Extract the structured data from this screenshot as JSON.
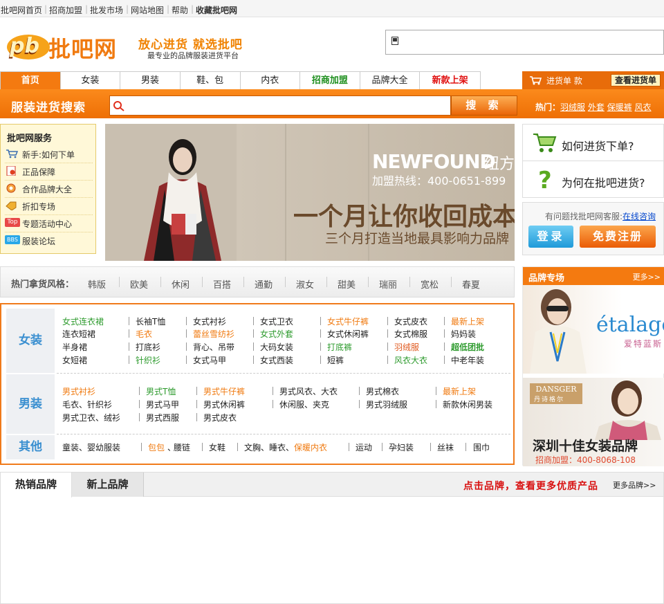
{
  "topbar": {
    "links": [
      "批吧网首页",
      "招商加盟",
      "批发市场",
      "网站地图",
      "帮助",
      "收藏批吧网"
    ]
  },
  "header": {
    "logo_text": "批吧网",
    "slogan": "放心进货  就选批吧",
    "subslogan": "最专业的品牌服装进货平台"
  },
  "nav": {
    "items": [
      "首页",
      "女装",
      "男装",
      "鞋、包",
      "内衣",
      "招商加盟",
      "品牌大全",
      "新款上架"
    ]
  },
  "cart": {
    "label": "进货单  款",
    "button": "查看进货单"
  },
  "search": {
    "title": "服装进货搜索",
    "placeholder": "",
    "button": "搜 索",
    "hot_label": "热门：",
    "hot": [
      "羽绒服",
      "外套",
      "保暖裤",
      "风衣"
    ]
  },
  "services": {
    "title": "批吧网服务",
    "items": [
      {
        "label": "新手:如何下单",
        "icon": "cart-icon"
      },
      {
        "label": "正品保障",
        "icon": "certificate-icon"
      },
      {
        "label": "合作品牌大全",
        "icon": "brand-icon"
      },
      {
        "label": "折扣专场",
        "icon": "discount-icon"
      },
      {
        "label": "专题活动中心",
        "icon": "top-badge-icon",
        "badge": "Top"
      },
      {
        "label": "服装论坛",
        "icon": "bbs-badge-icon",
        "badge": "BBS"
      }
    ]
  },
  "banner": {
    "brand": "NEWFOUND",
    "brand_mark": "纽方",
    "hotline": "加盟热线：400-0651-899",
    "headline": "一个月让你收回成本",
    "subline": "三个月打造当地最具影响力品牌"
  },
  "help": {
    "how_to_order": "如何进货下单?",
    "why_pibao": "为何在批吧进货?"
  },
  "account": {
    "question": "有问题找批吧网客服:",
    "online": "在线咨询",
    "login": "登录",
    "register": "免费注册"
  },
  "styles": {
    "label": "热门拿货风格：",
    "items": [
      "韩版",
      "欧美",
      "休闲",
      "百搭",
      "通勤",
      "淑女",
      "甜美",
      "瑞丽",
      "宽松",
      "春夏"
    ]
  },
  "categories": {
    "women": {
      "title": "女装",
      "rows": [
        [
          "女式连衣裙",
          "长袖T恤",
          "女式衬衫",
          "女式卫衣",
          "女式牛仔裤",
          "女式皮衣",
          "最新上架"
        ],
        [
          "连衣短裙",
          "毛衣",
          "蕾丝雪纺衫",
          "女式外套",
          "女式休闲裤",
          "女式棉服",
          "妈妈装"
        ],
        [
          "半身裙",
          "打底衫",
          "背心、吊带",
          "大码女装",
          "打底裤",
          "羽绒服",
          "超低团批"
        ],
        [
          "女短裙",
          "针织衫",
          "女式马甲",
          "女式西装",
          "短裤",
          "风衣大衣",
          "中老年装"
        ]
      ]
    },
    "men": {
      "title": "男装",
      "rows": [
        [
          "男式衬衫",
          "男式T恤",
          "男式牛仔裤",
          "男式风衣、大衣",
          "男式棉衣",
          "最新上架"
        ],
        [
          "毛衣、针织衫",
          "男式马甲",
          "男式休闲裤",
          "休闲服、夹克",
          "男式羽绒服",
          "新款休闲男装"
        ],
        [
          "男式卫衣、绒衫",
          "男式西服",
          "男式皮衣"
        ]
      ]
    },
    "other": {
      "title": "其他",
      "items": [
        "童装、婴幼服装",
        "包包",
        "腰链",
        "女鞋",
        "文胸、睡衣、",
        "保暖内衣",
        "运动",
        "孕妇装",
        "丝袜",
        "围巾"
      ]
    }
  },
  "brand_zone": {
    "title": "品牌专场",
    "more": "更多>>",
    "ad1": {
      "brand": "étalage",
      "sub": "爱特蓝斯"
    },
    "ad2": {
      "brand": "DANSGER",
      "sub": "丹诗格尔",
      "headline": "深圳十佳女装品牌",
      "hotline": "招商加盟：400-8068-108"
    }
  },
  "tabs": {
    "items": [
      "热销品牌",
      "新上品牌"
    ],
    "note": "点击品牌，查看更多优质产品",
    "more": "更多品牌>>"
  },
  "colors": {
    "accent": "#f47a10",
    "link_green": "#2e9b2e",
    "link_orange": "#f07a10",
    "category_blue": "#3a8fd0",
    "alert_red": "#d81010"
  }
}
